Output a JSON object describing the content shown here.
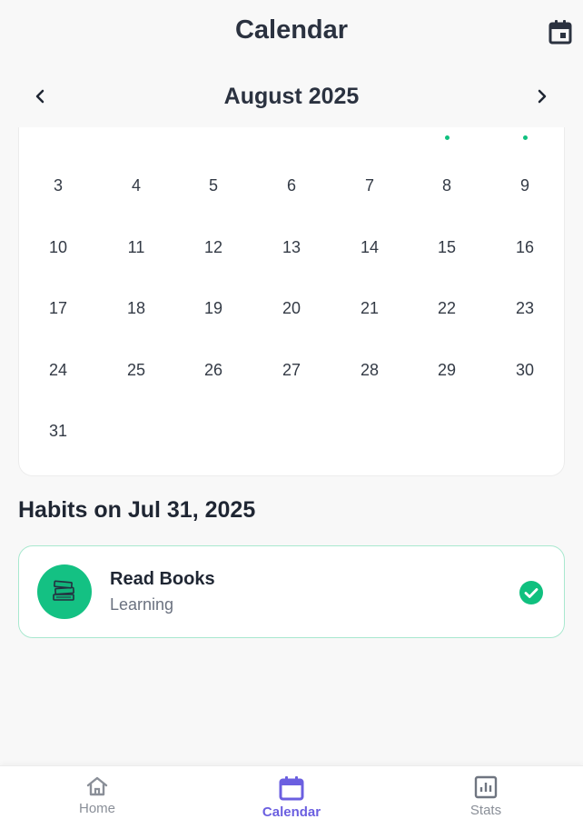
{
  "appbar": {
    "title": "Calendar",
    "action_icon": "calendar-icon"
  },
  "month_nav": {
    "title": "August 2025",
    "prev_icon": "chevron-left-icon",
    "next_icon": "chevron-right-icon"
  },
  "calendar": {
    "dot_color": "#10c07f",
    "weeks": [
      [
        "3",
        "4",
        "5",
        "6",
        "7",
        "8",
        "9"
      ],
      [
        "10",
        "11",
        "12",
        "13",
        "14",
        "15",
        "16"
      ],
      [
        "17",
        "18",
        "19",
        "20",
        "21",
        "22",
        "23"
      ],
      [
        "24",
        "25",
        "26",
        "27",
        "28",
        "29",
        "30"
      ],
      [
        "31",
        "",
        "",
        "",
        "",
        "",
        ""
      ]
    ]
  },
  "habits": {
    "heading": "Habits on Jul 31, 2025",
    "items": [
      {
        "name": "Read Books",
        "category": "Learning",
        "icon": "books-icon",
        "completed": true,
        "color": "#14c183"
      }
    ]
  },
  "bottom_nav": {
    "active_color": "#6b5fe0",
    "tabs": [
      {
        "label": "Home",
        "icon": "home-icon"
      },
      {
        "label": "Calendar",
        "icon": "calendar-icon",
        "active": true
      },
      {
        "label": "Stats",
        "icon": "stats-icon"
      }
    ]
  }
}
